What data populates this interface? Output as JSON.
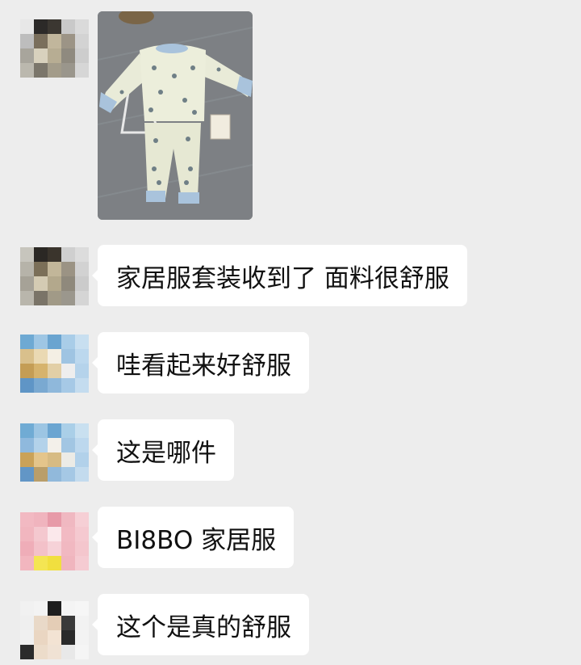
{
  "messages": [
    {
      "type": "image",
      "image_desc": "baby-pajama-set-photo"
    },
    {
      "type": "text",
      "text": "家居服套装收到了 面料很舒服"
    },
    {
      "type": "text",
      "text": "哇看起来好舒服"
    },
    {
      "type": "text",
      "text": "这是哪件"
    },
    {
      "type": "text",
      "text": "BI8BO 家居服"
    },
    {
      "type": "text",
      "text": "这个是真的舒服"
    }
  ],
  "colors": {
    "background": "#ededed",
    "bubble": "#ffffff",
    "text": "#111111"
  }
}
